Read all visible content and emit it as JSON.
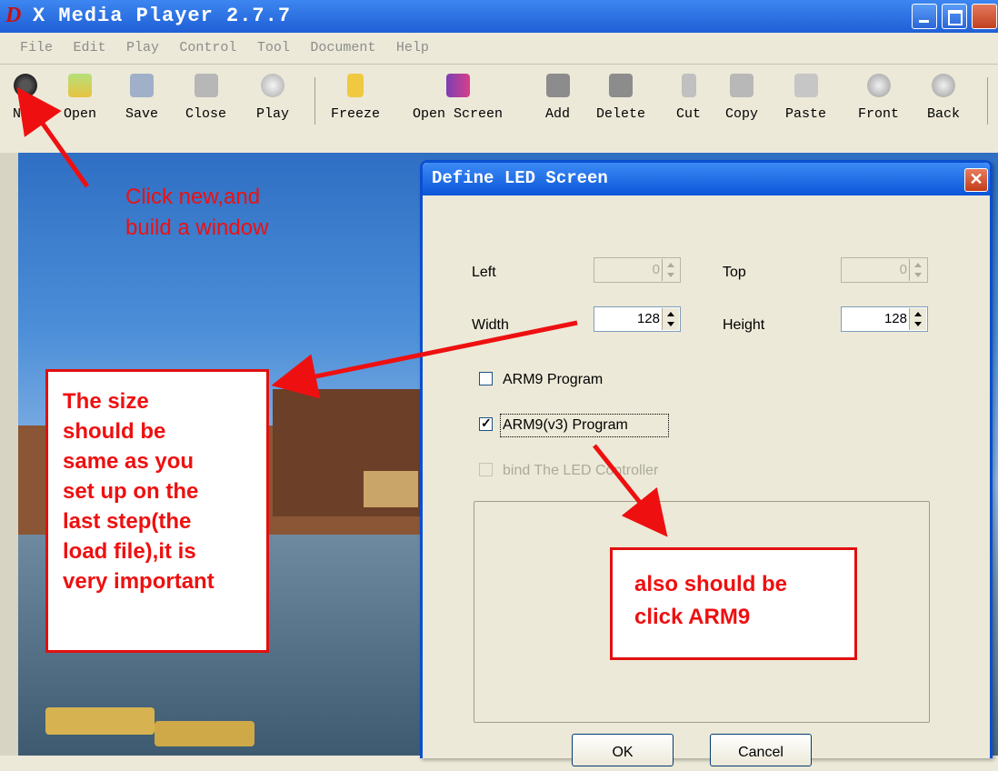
{
  "window": {
    "logo_glyph": "D",
    "title": "X Media Player 2.7.7"
  },
  "menu": [
    "File",
    "Edit",
    "Play",
    "Control",
    "Tool",
    "Document",
    "Help"
  ],
  "toolbar": {
    "items": [
      {
        "label": "New",
        "icon": "reel-icon"
      },
      {
        "label": "Open",
        "icon": "folder-open-icon"
      },
      {
        "label": "Save",
        "icon": "floppy-icon"
      },
      {
        "label": "Close",
        "icon": "close-file-icon"
      },
      {
        "label": "Play",
        "icon": "play-icon"
      },
      {
        "label": "Freeze",
        "icon": "lock-icon"
      },
      {
        "label": "Open Screen",
        "icon": "open-screen-icon"
      },
      {
        "label": "Add",
        "icon": "add-page-icon"
      },
      {
        "label": "Delete",
        "icon": "delete-page-icon"
      },
      {
        "label": "Cut",
        "icon": "scissors-icon"
      },
      {
        "label": "Copy",
        "icon": "copy-icon"
      },
      {
        "label": "Paste",
        "icon": "paste-icon"
      },
      {
        "label": "Front",
        "icon": "arrow-up-icon"
      },
      {
        "label": "Back",
        "icon": "arrow-down-icon"
      }
    ]
  },
  "dialog": {
    "title": "Define LED Screen",
    "close_glyph": "✕",
    "left_label": "Left",
    "left_value": "0",
    "top_label": "Top",
    "top_value": "0",
    "width_label": "Width",
    "width_value": "128",
    "height_label": "Height",
    "height_value": "128",
    "arm9_label": "ARM9 Program",
    "arm9_checked": false,
    "arm9v3_label": "ARM9(v3) Program",
    "arm9v3_checked": true,
    "check_glyph": "✓",
    "bind_label": "bind The LED Controller",
    "bind_checked": false,
    "ok_label": "OK",
    "cancel_label": "Cancel"
  },
  "annotations": {
    "click_new": "Click new,and\nbuild a window",
    "size_note": "The size\nshould be\nsame as you\nset up on the\nlast step(the\nload file),it is\nvery important",
    "arm9_note": "also should be\nclick ARM9"
  },
  "colors": {
    "annotation_red": "#ee1010",
    "xp_blue": "#0b55d8",
    "dialog_bg": "#ece9d8"
  }
}
